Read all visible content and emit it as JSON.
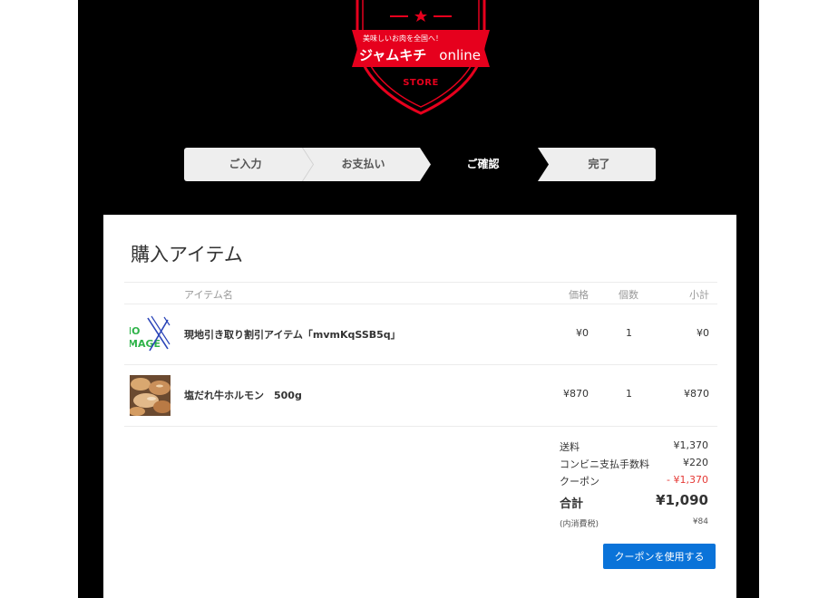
{
  "logo": {
    "tagline": "美味しいお肉を全国へ！",
    "name": "ジャムキチ",
    "name_en": "online",
    "store": "STORE",
    "colors": {
      "shield": "#e6001d",
      "bg": "#000000"
    }
  },
  "steps": [
    {
      "label": "ご入力",
      "active": false
    },
    {
      "label": "お支払い",
      "active": false
    },
    {
      "label": "ご確認",
      "active": true
    },
    {
      "label": "完了",
      "active": false
    }
  ],
  "card": {
    "title": "購入アイテム",
    "columns": {
      "name": "アイテム名",
      "price": "価格",
      "qty": "個数",
      "subtotal": "小計"
    },
    "items": [
      {
        "thumb": "no-image-icon",
        "name": "現地引き取り割引アイテム「mvmKqSSB5q」",
        "price": "¥0",
        "qty": "1",
        "subtotal": "¥0"
      },
      {
        "thumb": "meat-photo",
        "name": "塩だれ牛ホルモン　500g",
        "price": "¥870",
        "qty": "1",
        "subtotal": "¥870"
      }
    ],
    "no_image_text": {
      "line1": "IO",
      "line2": "MAGE"
    },
    "summary": {
      "shipping_label": "送料",
      "shipping": "¥1,370",
      "fee_label": "コンビニ支払手数料",
      "fee": "¥220",
      "coupon_label": "クーポン",
      "coupon": "- ¥1,370",
      "total_label": "合計",
      "total": "¥1,090",
      "tax_label": "(内消費税)",
      "tax": "¥84"
    },
    "coupon_button": "クーポンを使用する",
    "accent": "#0a73d9",
    "discount_color": "#e53935"
  }
}
